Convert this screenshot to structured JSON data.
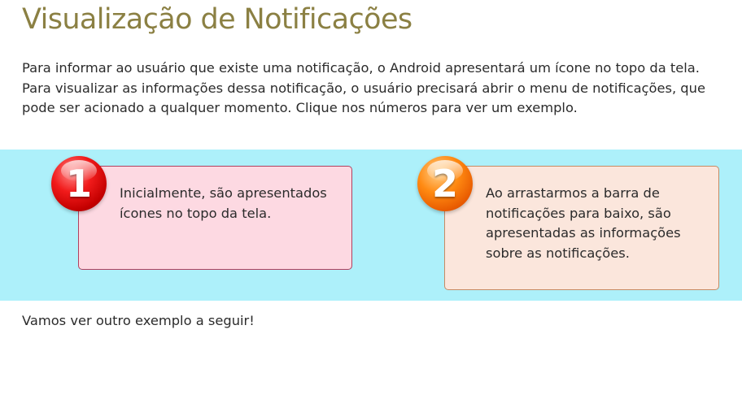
{
  "page": {
    "title": "Visualização de Notificações",
    "intro": "Para informar ao usuário que existe uma notificação, o Android apresentará um ícone no topo da tela. Para visualizar as informações dessa notificação, o usuário precisará abrir o menu de notificações, que pode ser acionado a qualquer momento. Clique nos números para ver um exemplo.",
    "footer": "Vamos ver outro exemplo a seguir!"
  },
  "steps": [
    {
      "number": "1",
      "text": "Inicialmente, são apresentados ícones no topo da tela.",
      "color": "#fdd9e2",
      "badge_color": "#e01010"
    },
    {
      "number": "2",
      "text": "Ao arrastarmos a barra de notificações para baixo, são apresentadas as informações sobre as notificações.",
      "color": "#fbe6dc",
      "badge_color": "#ff7a00"
    }
  ],
  "colors": {
    "title": "#8b8043",
    "band": "#adf0fa",
    "text": "#2b2b2b"
  }
}
